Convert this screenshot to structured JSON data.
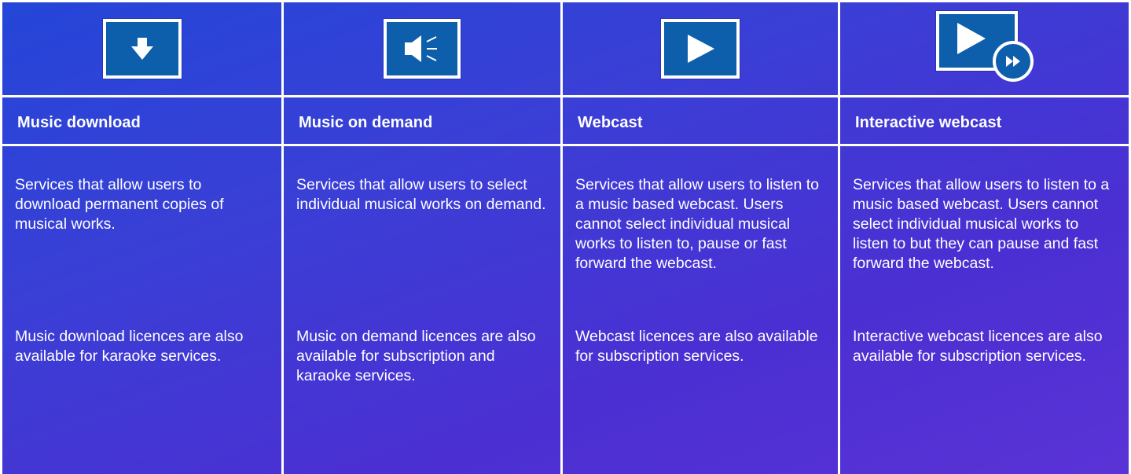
{
  "columns": [
    {
      "icon": "download-arrow-icon",
      "title": "Music download",
      "description": "Services that allow users to download permanent copies of musical works.",
      "note": "Music download licences are also available for karaoke services."
    },
    {
      "icon": "speaker-icon",
      "title": "Music on demand",
      "description": "Services that allow users to select individual musical works on demand.",
      "note": "Music on demand licences are also available for subscription and karaoke services."
    },
    {
      "icon": "play-icon",
      "title": "Webcast",
      "description": "Services that allow users to listen to a music based webcast. Users cannot select individual musical works to listen to, pause or fast forward the webcast.",
      "note": "Webcast licences are also available for subscription services."
    },
    {
      "icon": "play-fast-forward-icon",
      "title": "Interactive webcast",
      "description": "Services that allow users to listen to a music based webcast. Users cannot select individual musical works to listen to but they can pause and fast forward the webcast.",
      "note": "Interactive webcast licences are also available for subscription services."
    }
  ],
  "colors": {
    "icon_fill": "#0d5eab",
    "border": "#ffffff",
    "background_start": "#2446d8",
    "background_end": "#5a33d6"
  }
}
